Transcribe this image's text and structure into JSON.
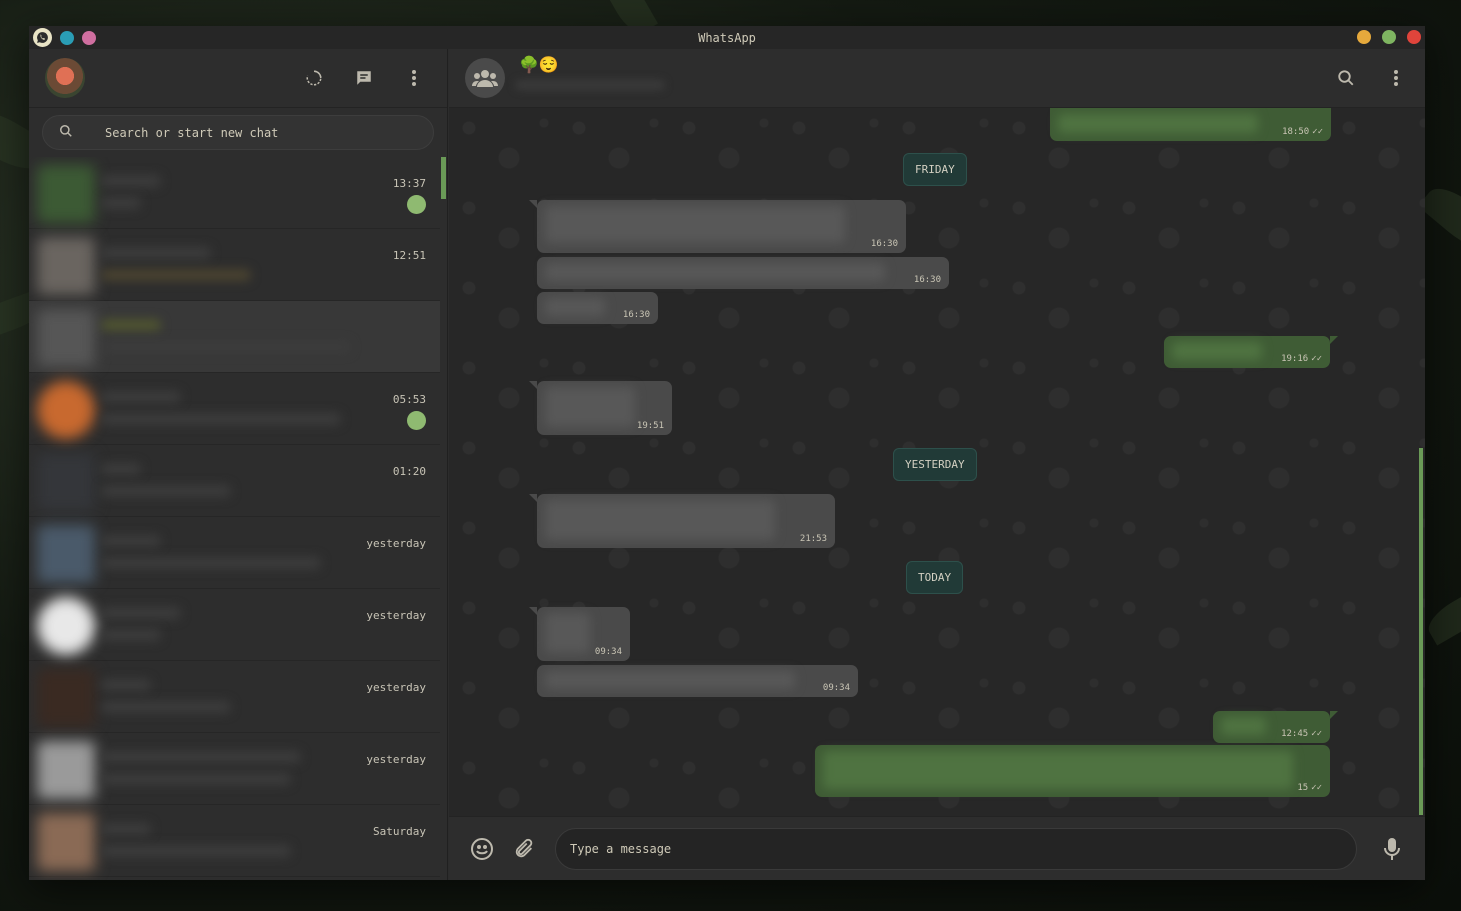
{
  "window": {
    "title": "WhatsApp",
    "left_dots": [
      "#2a9db5",
      "#d06fa0"
    ],
    "right_dots": [
      "#e6a93c",
      "#7fb561",
      "#e0443b"
    ]
  },
  "sidebar": {
    "icons": [
      "status-icon",
      "new-chat-icon",
      "menu-icon"
    ],
    "search_placeholder": "Search or start new chat",
    "chats": [
      {
        "time": "13:37",
        "unread": true,
        "avatar": "#3c5a34"
      },
      {
        "time": "12:51",
        "unread": false,
        "avatar": "#6a6560"
      },
      {
        "time": "",
        "unread": false,
        "avatar": "#565656"
      },
      {
        "time": "05:53",
        "unread": true,
        "avatar": "#c8692f"
      },
      {
        "time": "01:20",
        "unread": false,
        "avatar": "#34363a"
      },
      {
        "time": "yesterday",
        "unread": false,
        "avatar": "#4a5a6a"
      },
      {
        "time": "yesterday",
        "unread": false,
        "avatar": "#e8e8e8"
      },
      {
        "time": "yesterday",
        "unread": false,
        "avatar": "#3a2a22"
      },
      {
        "time": "yesterday",
        "unread": false,
        "avatar": "#9a9a9a"
      },
      {
        "time": "Saturday",
        "unread": false,
        "avatar": "#8a6a55"
      }
    ]
  },
  "conversation": {
    "group_emoji": "🌳😌",
    "day_labels": {
      "friday": "FRIDAY",
      "yesterday": "YESTERDAY",
      "today": "TODAY"
    },
    "messages": {
      "m1": "18:50",
      "m2": "16:30",
      "m3": "16:30",
      "m4": "16:30",
      "m5": "19:16",
      "m6": "19:51",
      "m7": "21:53",
      "m8": "09:34",
      "m9": "09:34",
      "m10": "12:45",
      "m11": "15"
    },
    "composer_placeholder": "Type a message"
  }
}
